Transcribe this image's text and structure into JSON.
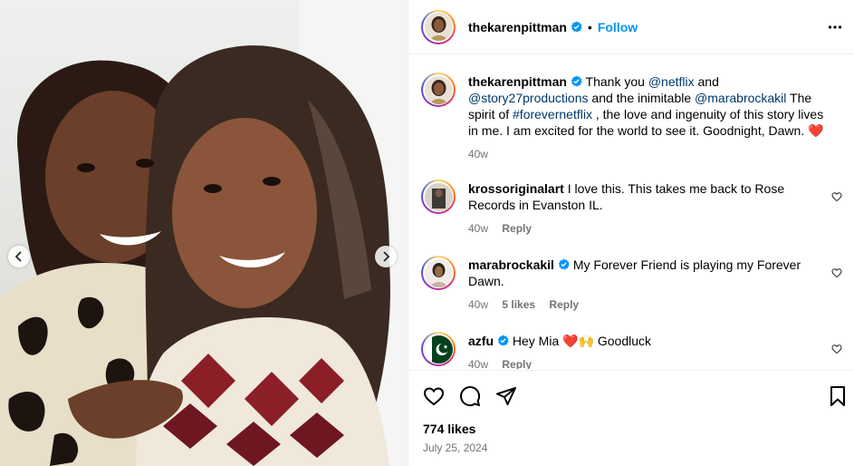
{
  "post": {
    "author": "thekarenpittman",
    "follow_label": "Follow",
    "dot": "•",
    "caption": {
      "user": "thekarenpittman",
      "t1": " Thank you ",
      "m1": "@netflix",
      "t2": " and ",
      "m2": "@story27productions",
      "t3": " and the inimitable ",
      "m3": "@marabrockakil",
      "t4": " The spirit of ",
      "m4": "#forevernetflix",
      "t5": " , the love and ingenuity of this story lives in me. I am excited for the world to see it. Goodnight, Dawn. ",
      "emoji": "❤️",
      "time": "40w"
    },
    "comments": [
      {
        "user": "krossoriginalart",
        "text": " I love this. This takes me back to Rose Records in Evanston IL.",
        "time": "40w",
        "likes": "",
        "reply": "Reply"
      },
      {
        "user": "marabrockakil",
        "text": " My Forever Friend is playing my Forever Dawn.",
        "time": "40w",
        "likes": "5 likes",
        "reply": "Reply"
      },
      {
        "user": "azfu",
        "text": " Hey Mia ❤️🙌 Goodluck",
        "time": "40w",
        "likes": "",
        "reply": "Reply"
      }
    ],
    "likes": "774 likes",
    "date": "July 25, 2024"
  },
  "colors": {
    "link_blue": "#0095f6",
    "mention": "#00376b",
    "muted": "#737373",
    "verified": "#0095f6"
  },
  "icons": [
    "chevron-left-icon",
    "chevron-right-icon",
    "more-options-icon",
    "verified-badge-icon",
    "heart-icon",
    "comment-icon",
    "share-icon",
    "bookmark-icon"
  ]
}
